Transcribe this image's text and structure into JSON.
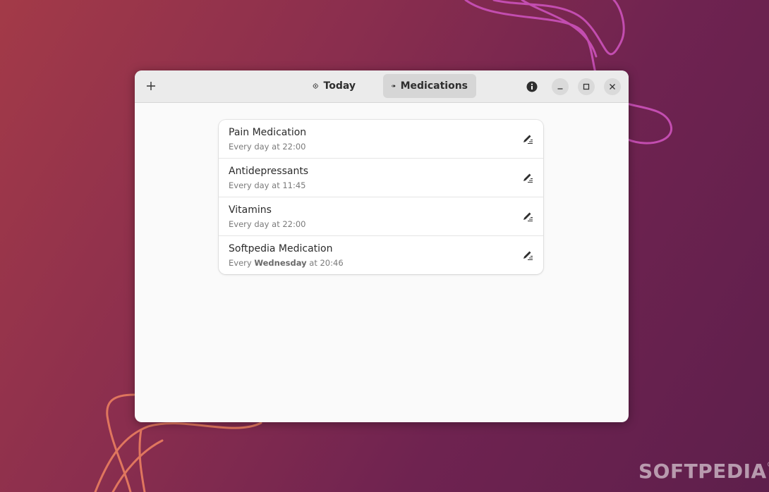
{
  "header": {
    "add_icon": "plus-icon",
    "tabs": [
      {
        "label": "Today",
        "icon": "target-icon"
      },
      {
        "label": "Medications",
        "icon": "toggle-icon",
        "selected": true
      }
    ],
    "info_icon": "info-icon",
    "window_controls": [
      "minimize-icon",
      "maximize-icon",
      "close-icon"
    ]
  },
  "medications": [
    {
      "name": "Pain Medication",
      "schedule_prefix": "Every day at 22:00",
      "schedule_day": "",
      "schedule_suffix": ""
    },
    {
      "name": "Antidepressants",
      "schedule_prefix": "Every day at 11:45",
      "schedule_day": "",
      "schedule_suffix": ""
    },
    {
      "name": "Vitamins",
      "schedule_prefix": "Every day at 22:00",
      "schedule_day": "",
      "schedule_suffix": ""
    },
    {
      "name": "Softpedia Medication",
      "schedule_prefix": "Every ",
      "schedule_day": "Wednesday",
      "schedule_suffix": " at 20:46"
    }
  ],
  "watermark": {
    "text": "SOFTPEDIA",
    "mark": "®"
  },
  "colors": {
    "selected_tab_bg": "#d6d6d6",
    "window_bg": "#fafafa",
    "wallpaper_line": "#c34db0",
    "wallpaper_line_orange": "#e0765e"
  }
}
